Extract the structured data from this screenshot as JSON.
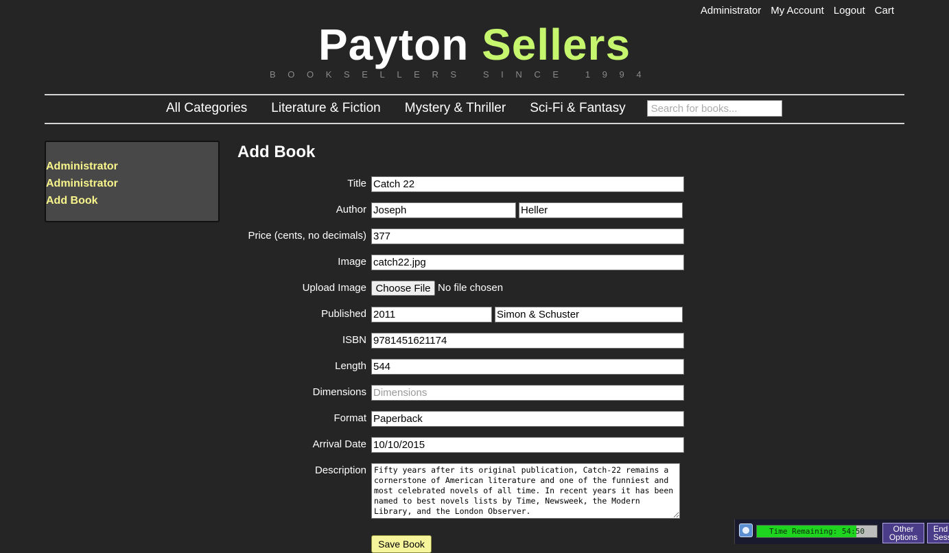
{
  "top_links": [
    "Administrator",
    "My Account",
    "Logout",
    "Cart"
  ],
  "logo": {
    "part1": "Payton",
    "part2": "Sellers",
    "tagline": "BOOKSELLERS SINCE 1994"
  },
  "nav": {
    "items": [
      "All Categories",
      "Literature & Fiction",
      "Mystery & Thriller",
      "Sci-Fi & Fantasy"
    ],
    "search_placeholder": "Search for books..."
  },
  "sidebar": {
    "items": [
      "Administrator",
      "Administrator",
      "Add Book"
    ]
  },
  "page_title": "Add Book",
  "form": {
    "title": {
      "label": "Title",
      "value": "Catch 22"
    },
    "author": {
      "label": "Author",
      "first": "Joseph",
      "last": "Heller"
    },
    "price": {
      "label": "Price (cents, no decimals)",
      "value": "377"
    },
    "image": {
      "label": "Image",
      "value": "catch22.jpg"
    },
    "upload": {
      "label": "Upload Image",
      "button": "Choose File",
      "status": "No file chosen"
    },
    "published": {
      "label": "Published",
      "year": "2011",
      "publisher": "Simon & Schuster"
    },
    "isbn": {
      "label": "ISBN",
      "value": "9781451621174"
    },
    "length": {
      "label": "Length",
      "value": "544"
    },
    "dimensions": {
      "label": "Dimensions",
      "value": "",
      "placeholder": "Dimensions"
    },
    "format": {
      "label": "Format",
      "value": "Paperback"
    },
    "arrival": {
      "label": "Arrival Date",
      "value": "10/10/2015"
    },
    "description": {
      "label": "Description",
      "value": "Fifty years after its original publication, Catch-22 remains a cornerstone of American literature and one of the funniest and most celebrated novels of all time. In recent years it has been named to best novels lists by Time, Newsweek, the Modern Library, and the London Observer."
    },
    "save_button": "Save Book"
  },
  "session": {
    "time_remaining": "Time Remaining: 54:50",
    "time_fraction": 0.83,
    "other_options_line1": "Other",
    "other_options_line2": "Options",
    "end_session_line1": "End",
    "end_session_line2": "Session"
  },
  "colors": {
    "accent": "#c6f56e",
    "sidebar_link": "#f8f58c",
    "save_button": "#f7f59c",
    "timer_fill": "#1fd41f"
  }
}
